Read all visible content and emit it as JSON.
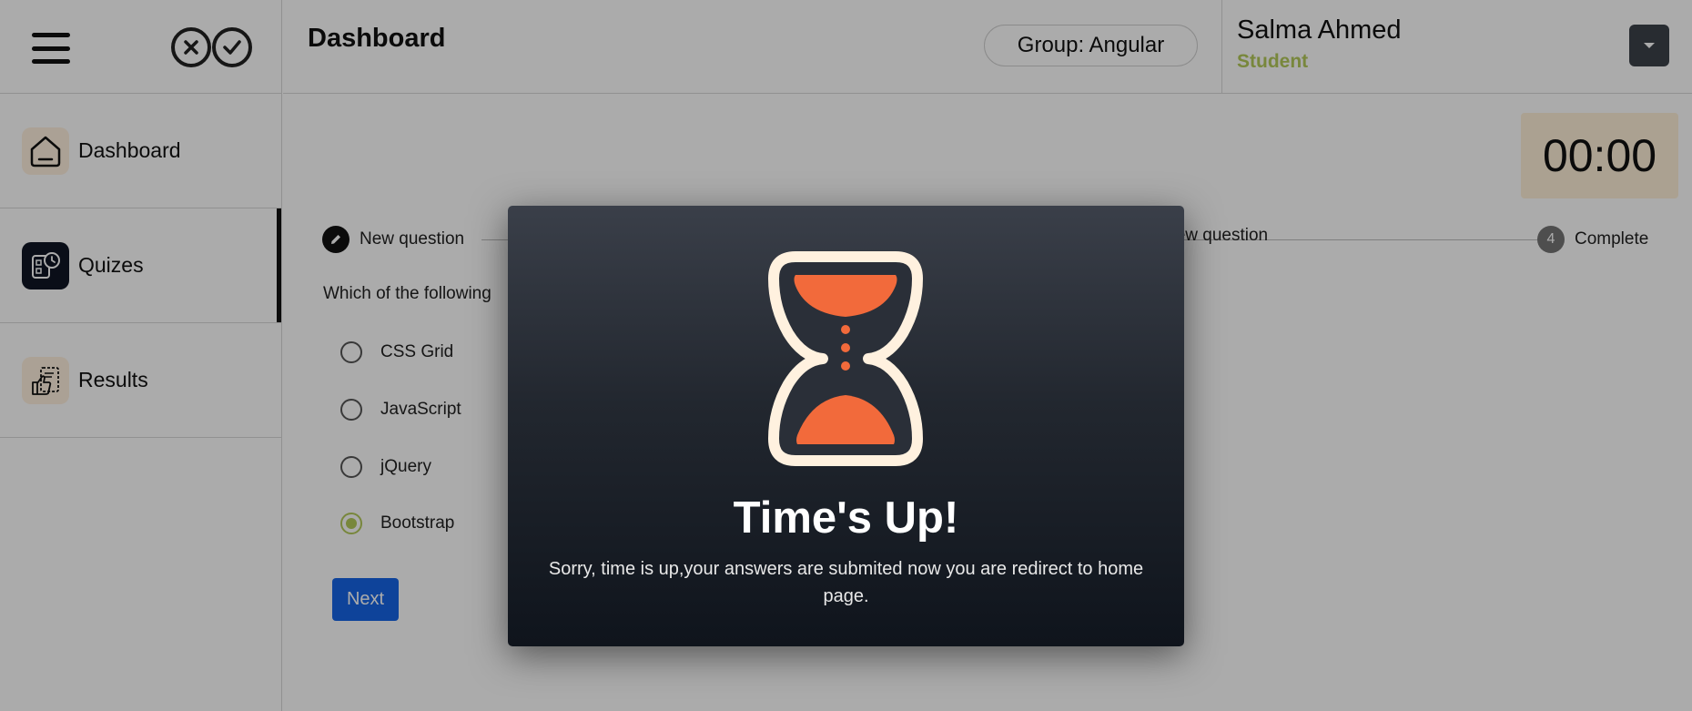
{
  "sidebar": {
    "items": [
      {
        "label": "Dashboard",
        "icon": "home-icon"
      },
      {
        "label": "Quizes",
        "icon": "quiz-icon"
      },
      {
        "label": "Results",
        "icon": "results-icon"
      }
    ],
    "active_item": "Quizes"
  },
  "header": {
    "title": "Dashboard",
    "group": "Group: Angular",
    "user_name": "Salma Ahmed",
    "user_role": "Student"
  },
  "timer": "00:00",
  "stepper": {
    "steps": [
      {
        "label": "New question",
        "marker": "pencil-icon"
      },
      {
        "label": "New question",
        "marker": ""
      },
      {
        "label": "Complete",
        "marker": "4"
      }
    ]
  },
  "question": {
    "text": "Which of the following",
    "options": [
      "CSS Grid",
      "JavaScript",
      "jQuery",
      "Bootstrap"
    ],
    "selected": "Bootstrap"
  },
  "next_label": "Next",
  "modal": {
    "title": "Time's Up!",
    "message": "Sorry, time is up,your answers are submited now you are redirect to home page.",
    "icon": "hourglass-icon"
  },
  "colors": {
    "accent_green": "#b3c95a",
    "primary_blue": "#1565e6",
    "timer_bg": "#fff0d9",
    "hourglass_orange": "#f26a3b",
    "hourglass_frame": "#fff1df"
  }
}
